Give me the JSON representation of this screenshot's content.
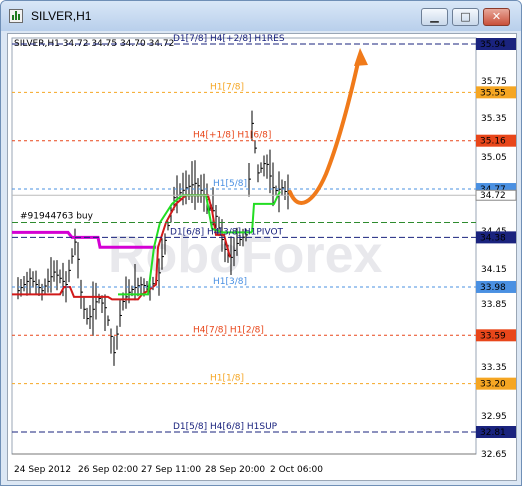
{
  "window": {
    "title": "SILVER,H1",
    "buttons": {
      "minimize": "▁",
      "maximize": "□",
      "close": "✕"
    },
    "accent": "#b8cfeb"
  },
  "chart": {
    "header_text": "SILVER,H1  34.72 34.75 34.70 34.72",
    "watermark": "RoboForex",
    "trade_label": "#91944763 buy",
    "y_ticks": [
      "35.75",
      "35.35",
      "35.05",
      "34.45",
      "34.15",
      "33.85",
      "33.35",
      "32.95",
      "32.65"
    ],
    "x_ticks": [
      "24 Sep 2012",
      "26 Sep 02:00",
      "27 Sep 11:00",
      "28 Sep 20:00",
      "2 Oct 06:00"
    ],
    "levels": [
      {
        "price": 35.94,
        "label": "D1[7/8] H4[+2/8] H1RES",
        "tag": "35.94",
        "color": "#1a237e",
        "dash": "6,3",
        "label_color": "#1a237e"
      },
      {
        "price": 35.55,
        "label": "H1[7/8]",
        "tag": "35.55",
        "color": "#f5a623",
        "dash": "3,3",
        "label_color": "#f5a623"
      },
      {
        "price": 35.16,
        "label": "H4[+1/8] H1[6/8]",
        "tag": "35.16",
        "color": "#e8461a",
        "dash": "3,3",
        "label_color": "#e8461a"
      },
      {
        "price": 34.77,
        "label": "H1[5/8]",
        "tag": "34.77",
        "color": "#4a90e2",
        "dash": "3,3",
        "label_color": "#4a90e2"
      },
      {
        "price": 34.38,
        "label": "D1[6/8] H4[3/8] H1PIVOT",
        "tag": "34.38",
        "color": "#1a237e",
        "dash": "6,3",
        "label_color": "#1a237e"
      },
      {
        "price": 33.98,
        "label": "H1[3/8]",
        "tag": "33.98",
        "color": "#4a90e2",
        "dash": "3,3",
        "label_color": "#4a90e2"
      },
      {
        "price": 33.59,
        "label": "H4[7/8] H1[2/8]",
        "tag": "33.59",
        "color": "#e8461a",
        "dash": "3,3",
        "label_color": "#e8461a"
      },
      {
        "price": 33.2,
        "label": "H1[1/8]",
        "tag": "33.20",
        "color": "#f5a623",
        "dash": "3,3",
        "label_color": "#f5a623"
      },
      {
        "price": 32.81,
        "label": "D1[5/8] H4[6/8] H1SUP",
        "tag": "32.81",
        "color": "#1a237e",
        "dash": "6,3",
        "label_color": "#1a237e"
      }
    ],
    "current_price": {
      "value": "34.72",
      "bid_tag": "34.77"
    },
    "colors": {
      "price_bars": "#000000",
      "ma_fast": "#22dd22",
      "ma_slow": "#d400d4",
      "ma_red": "#d11a1a",
      "arrow": "#f07a1a",
      "trade_line": "#2e8b2e"
    }
  }
}
